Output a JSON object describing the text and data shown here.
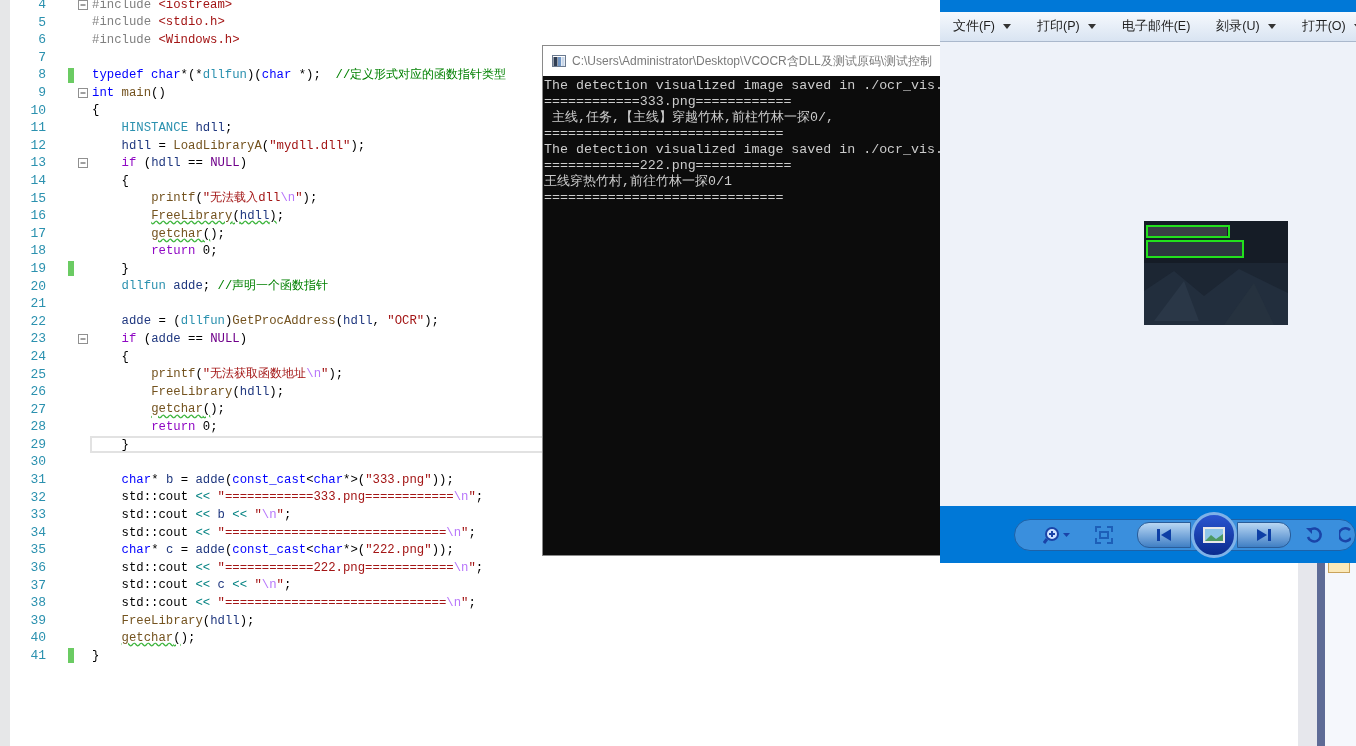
{
  "editor": {
    "lines": [
      {
        "number": "4",
        "changed": false,
        "fold": true,
        "current": false,
        "tokens": [
          {
            "text": "#include",
            "kind": "pre"
          },
          {
            "text": " <iostream>",
            "kind": "inc"
          }
        ]
      },
      {
        "number": "5",
        "changed": false,
        "fold": false,
        "current": false,
        "tokens": [
          {
            "text": "#include",
            "kind": "pre"
          },
          {
            "text": " <stdio.h>",
            "kind": "inc"
          }
        ]
      },
      {
        "number": "6",
        "changed": false,
        "fold": false,
        "current": false,
        "tokens": [
          {
            "text": "#include",
            "kind": "pre"
          },
          {
            "text": " <Windows.h>",
            "kind": "inc"
          }
        ]
      },
      {
        "number": "7",
        "changed": false,
        "fold": false,
        "current": false
      },
      {
        "number": "8",
        "changed": true,
        "fold": false,
        "current": false,
        "tokens": [
          {
            "text": "typedef",
            "kind": "kw"
          },
          {
            "text": " char",
            "kind": "kw"
          },
          {
            "text": "*(*",
            "kind": "p"
          },
          {
            "text": "dllfun",
            "kind": "type"
          },
          {
            "text": ")(",
            "kind": "p"
          },
          {
            "text": "char",
            "kind": "kw"
          },
          {
            "text": " *);  ",
            "kind": "p"
          },
          {
            "text": "//定义形式对应的函数指针类型",
            "kind": "cmt"
          }
        ]
      },
      {
        "number": "9",
        "changed": false,
        "fold": true,
        "current": false,
        "tokens": [
          {
            "text": "int",
            "kind": "kw"
          },
          {
            "text": " main",
            "kind": "fn"
          },
          {
            "text": "()",
            "kind": "p"
          }
        ]
      },
      {
        "number": "10",
        "changed": false,
        "fold": false,
        "current": false,
        "tokens": [
          {
            "text": "{",
            "kind": "p"
          }
        ]
      },
      {
        "number": "11",
        "changed": false,
        "fold": false,
        "current": false,
        "tokens": [
          {
            "text": "    HINSTANCE",
            "kind": "type"
          },
          {
            "text": " hdll",
            "kind": "var"
          },
          {
            "text": ";",
            "kind": "p"
          }
        ]
      },
      {
        "number": "12",
        "changed": false,
        "fold": false,
        "current": false,
        "tokens": [
          {
            "text": "    hdll",
            "kind": "var"
          },
          {
            "text": " = ",
            "kind": "p"
          },
          {
            "text": "LoadLibraryA",
            "kind": "fn"
          },
          {
            "text": "(",
            "kind": "p"
          },
          {
            "text": "\"mydll.dll\"",
            "kind": "str"
          },
          {
            "text": ");",
            "kind": "p"
          }
        ]
      },
      {
        "number": "13",
        "changed": false,
        "fold": true,
        "current": false,
        "tokens": [
          {
            "text": "    if",
            "kind": "ctl"
          },
          {
            "text": " (",
            "kind": "p"
          },
          {
            "text": "hdll",
            "kind": "var"
          },
          {
            "text": " == ",
            "kind": "p"
          },
          {
            "text": "NULL",
            "kind": "mac"
          },
          {
            "text": ")",
            "kind": "p"
          }
        ]
      },
      {
        "number": "14",
        "changed": false,
        "fold": false,
        "current": false,
        "tokens": [
          {
            "text": "    {",
            "kind": "p"
          }
        ]
      },
      {
        "number": "15",
        "changed": false,
        "fold": false,
        "current": false,
        "tokens": [
          {
            "text": "        printf",
            "kind": "fn"
          },
          {
            "text": "(",
            "kind": "p"
          },
          {
            "text": "\"无法载入dll",
            "kind": "str"
          },
          {
            "text": "\\n",
            "kind": "esc"
          },
          {
            "text": "\"",
            "kind": "str"
          },
          {
            "text": ");",
            "kind": "p"
          }
        ]
      },
      {
        "number": "16",
        "changed": false,
        "fold": false,
        "current": false,
        "tokens": [
          {
            "text": "        FreeLibrary",
            "kind": "fn_warn"
          },
          {
            "text": "(",
            "kind": "p_warn"
          },
          {
            "text": "hdll",
            "kind": "var_warn"
          },
          {
            "text": ")",
            "kind": "p_warn"
          },
          {
            "text": ";",
            "kind": "p"
          }
        ]
      },
      {
        "number": "17",
        "changed": false,
        "fold": false,
        "current": false,
        "tokens": [
          {
            "text": "        getchar",
            "kind": "fn_warn"
          },
          {
            "text": "(",
            "kind": "p_warn"
          },
          {
            "text": ");",
            "kind": "p"
          }
        ]
      },
      {
        "number": "18",
        "changed": false,
        "fold": false,
        "current": false,
        "tokens": [
          {
            "text": "        return",
            "kind": "ctl"
          },
          {
            "text": " 0;",
            "kind": "p"
          }
        ]
      },
      {
        "number": "19",
        "changed": true,
        "fold": false,
        "current": false,
        "tokens": [
          {
            "text": "    }",
            "kind": "p"
          }
        ]
      },
      {
        "number": "20",
        "changed": false,
        "fold": false,
        "current": false,
        "tokens": [
          {
            "text": "    dllfun",
            "kind": "type"
          },
          {
            "text": " adde",
            "kind": "var"
          },
          {
            "text": "; ",
            "kind": "p"
          },
          {
            "text": "//声明一个函数指针",
            "kind": "cmt"
          }
        ]
      },
      {
        "number": "21",
        "changed": false,
        "fold": false,
        "current": false
      },
      {
        "number": "22",
        "changed": false,
        "fold": false,
        "current": false,
        "tokens": [
          {
            "text": "    adde",
            "kind": "var"
          },
          {
            "text": " = (",
            "kind": "p"
          },
          {
            "text": "dllfun",
            "kind": "type"
          },
          {
            "text": ")",
            "kind": "p"
          },
          {
            "text": "GetProcAddress",
            "kind": "fn"
          },
          {
            "text": "(",
            "kind": "p"
          },
          {
            "text": "hdll",
            "kind": "var"
          },
          {
            "text": ", ",
            "kind": "p"
          },
          {
            "text": "\"OCR\"",
            "kind": "str"
          },
          {
            "text": ");",
            "kind": "p"
          }
        ]
      },
      {
        "number": "23",
        "changed": false,
        "fold": true,
        "current": false,
        "tokens": [
          {
            "text": "    if",
            "kind": "ctl"
          },
          {
            "text": " (",
            "kind": "p"
          },
          {
            "text": "adde",
            "kind": "var"
          },
          {
            "text": " == ",
            "kind": "p"
          },
          {
            "text": "NULL",
            "kind": "mac"
          },
          {
            "text": ")",
            "kind": "p"
          }
        ]
      },
      {
        "number": "24",
        "changed": false,
        "fold": false,
        "current": false,
        "tokens": [
          {
            "text": "    {",
            "kind": "p"
          }
        ]
      },
      {
        "number": "25",
        "changed": false,
        "fold": false,
        "current": false,
        "tokens": [
          {
            "text": "        printf",
            "kind": "fn"
          },
          {
            "text": "(",
            "kind": "p"
          },
          {
            "text": "\"无法获取函数地址",
            "kind": "str"
          },
          {
            "text": "\\n",
            "kind": "esc"
          },
          {
            "text": "\"",
            "kind": "str"
          },
          {
            "text": ");",
            "kind": "p"
          }
        ]
      },
      {
        "number": "26",
        "changed": false,
        "fold": false,
        "current": false,
        "tokens": [
          {
            "text": "        FreeLibrary",
            "kind": "fn"
          },
          {
            "text": "(",
            "kind": "p"
          },
          {
            "text": "hdll",
            "kind": "var"
          },
          {
            "text": ");",
            "kind": "p"
          }
        ]
      },
      {
        "number": "27",
        "changed": false,
        "fold": false,
        "current": false,
        "tokens": [
          {
            "text": "        getchar",
            "kind": "fn_warn"
          },
          {
            "text": "(",
            "kind": "p_warn"
          },
          {
            "text": ");",
            "kind": "p"
          }
        ]
      },
      {
        "number": "28",
        "changed": false,
        "fold": false,
        "current": false,
        "tokens": [
          {
            "text": "        return",
            "kind": "ctl"
          },
          {
            "text": " 0;",
            "kind": "p"
          }
        ]
      },
      {
        "number": "29",
        "changed": false,
        "fold": false,
        "current": true,
        "tokens": [
          {
            "text": "    }",
            "kind": "p"
          }
        ]
      },
      {
        "number": "30",
        "changed": false,
        "fold": false,
        "current": false
      },
      {
        "number": "31",
        "changed": false,
        "fold": false,
        "current": false,
        "tokens": [
          {
            "text": "    char",
            "kind": "kw"
          },
          {
            "text": "* ",
            "kind": "p"
          },
          {
            "text": "b",
            "kind": "var"
          },
          {
            "text": " = ",
            "kind": "p"
          },
          {
            "text": "adde",
            "kind": "var"
          },
          {
            "text": "(",
            "kind": "p"
          },
          {
            "text": "const_cast",
            "kind": "kw"
          },
          {
            "text": "<",
            "kind": "p"
          },
          {
            "text": "char",
            "kind": "kw"
          },
          {
            "text": "*>(",
            "kind": "p"
          },
          {
            "text": "\"333.png\"",
            "kind": "str"
          },
          {
            "text": "));",
            "kind": "p"
          }
        ]
      },
      {
        "number": "32",
        "changed": false,
        "fold": false,
        "current": false,
        "tokens": [
          {
            "text": "    std::cout",
            "kind": "p"
          },
          {
            "text": " <<",
            "kind": "op"
          },
          {
            "text": " \"============333.png============",
            "kind": "str"
          },
          {
            "text": "\\n",
            "kind": "esc"
          },
          {
            "text": "\"",
            "kind": "str"
          },
          {
            "text": ";",
            "kind": "p"
          }
        ]
      },
      {
        "number": "33",
        "changed": false,
        "fold": false,
        "current": false,
        "tokens": [
          {
            "text": "    std::cout",
            "kind": "p"
          },
          {
            "text": " <<",
            "kind": "op"
          },
          {
            "text": " b",
            "kind": "var"
          },
          {
            "text": " <<",
            "kind": "op"
          },
          {
            "text": " \"",
            "kind": "str"
          },
          {
            "text": "\\n",
            "kind": "esc"
          },
          {
            "text": "\"",
            "kind": "str"
          },
          {
            "text": ";",
            "kind": "p"
          }
        ]
      },
      {
        "number": "34",
        "changed": false,
        "fold": false,
        "current": false,
        "tokens": [
          {
            "text": "    std::cout",
            "kind": "p"
          },
          {
            "text": " <<",
            "kind": "op"
          },
          {
            "text": " \"==============================",
            "kind": "str"
          },
          {
            "text": "\\n",
            "kind": "esc"
          },
          {
            "text": "\"",
            "kind": "str"
          },
          {
            "text": ";",
            "kind": "p"
          }
        ]
      },
      {
        "number": "35",
        "changed": false,
        "fold": false,
        "current": false,
        "tokens": [
          {
            "text": "    char",
            "kind": "kw"
          },
          {
            "text": "* ",
            "kind": "p"
          },
          {
            "text": "c",
            "kind": "var"
          },
          {
            "text": " = ",
            "kind": "p"
          },
          {
            "text": "adde",
            "kind": "var"
          },
          {
            "text": "(",
            "kind": "p"
          },
          {
            "text": "const_cast",
            "kind": "kw"
          },
          {
            "text": "<",
            "kind": "p"
          },
          {
            "text": "char",
            "kind": "kw"
          },
          {
            "text": "*>(",
            "kind": "p"
          },
          {
            "text": "\"222.png\"",
            "kind": "str"
          },
          {
            "text": "));",
            "kind": "p"
          }
        ]
      },
      {
        "number": "36",
        "changed": false,
        "fold": false,
        "current": false,
        "tokens": [
          {
            "text": "    std::cout",
            "kind": "p"
          },
          {
            "text": " <<",
            "kind": "op"
          },
          {
            "text": " \"============222.png============",
            "kind": "str"
          },
          {
            "text": "\\n",
            "kind": "esc"
          },
          {
            "text": "\"",
            "kind": "str"
          },
          {
            "text": ";",
            "kind": "p"
          }
        ]
      },
      {
        "number": "37",
        "changed": false,
        "fold": false,
        "current": false,
        "tokens": [
          {
            "text": "    std::cout",
            "kind": "p"
          },
          {
            "text": " <<",
            "kind": "op"
          },
          {
            "text": " c",
            "kind": "var"
          },
          {
            "text": " <<",
            "kind": "op"
          },
          {
            "text": " \"",
            "kind": "str"
          },
          {
            "text": "\\n",
            "kind": "esc"
          },
          {
            "text": "\"",
            "kind": "str"
          },
          {
            "text": ";",
            "kind": "p"
          }
        ]
      },
      {
        "number": "38",
        "changed": false,
        "fold": false,
        "current": false,
        "tokens": [
          {
            "text": "    std::cout",
            "kind": "p"
          },
          {
            "text": " <<",
            "kind": "op"
          },
          {
            "text": " \"==============================",
            "kind": "str"
          },
          {
            "text": "\\n",
            "kind": "esc"
          },
          {
            "text": "\"",
            "kind": "str"
          },
          {
            "text": ";",
            "kind": "p"
          }
        ]
      },
      {
        "number": "39",
        "changed": false,
        "fold": false,
        "current": false,
        "tokens": [
          {
            "text": "    FreeLibrary",
            "kind": "fn"
          },
          {
            "text": "(",
            "kind": "p"
          },
          {
            "text": "hdll",
            "kind": "var"
          },
          {
            "text": ");",
            "kind": "p"
          }
        ]
      },
      {
        "number": "40",
        "changed": false,
        "fold": false,
        "current": false,
        "tokens": [
          {
            "text": "    getchar",
            "kind": "fn_warn"
          },
          {
            "text": "(",
            "kind": "p_warn"
          },
          {
            "text": ");",
            "kind": "p"
          }
        ]
      },
      {
        "number": "41",
        "changed": true,
        "fold": false,
        "current": false,
        "tokens": [
          {
            "text": "}",
            "kind": "p"
          }
        ]
      }
    ]
  },
  "console": {
    "title": "C:\\Users\\Administrator\\Desktop\\VCOCR含DLL及测试原码\\测试控制",
    "lines": [
      "The detection visualized image saved in ./ocr_vis.",
      "============333.png============",
      " 主线,任务,【主线】穿越竹林,前柱竹林一探0/,",
      "==============================",
      "The detection visualized image saved in ./ocr_vis.",
      "============222.png============",
      "王线穿热竹村,前往竹林一探0/1",
      "=============================="
    ]
  },
  "photo_viewer": {
    "menu": [
      {
        "label": "文件(F)",
        "dropdown": true
      },
      {
        "label": "打印(P)",
        "dropdown": true
      },
      {
        "label": "电子邮件(E)",
        "dropdown": false
      },
      {
        "label": "刻录(U)",
        "dropdown": true
      },
      {
        "label": "打开(O)",
        "dropdown": true
      }
    ]
  }
}
